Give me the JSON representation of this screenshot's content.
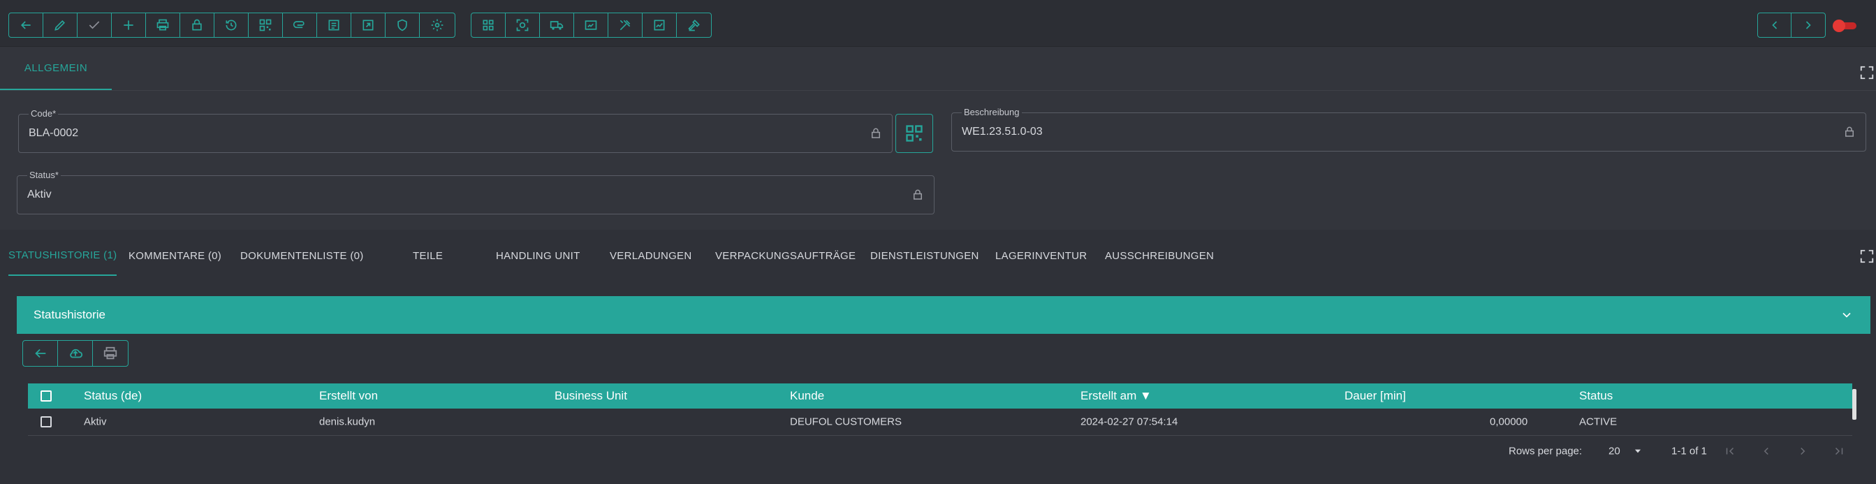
{
  "toolbar": {
    "group1_icons": [
      "back-arrow-icon",
      "pencil-icon",
      "check-icon",
      "plus-icon",
      "printer-icon",
      "lock-icon",
      "history-icon",
      "qr-code-icon",
      "paperclip-icon",
      "notes-icon",
      "export-icon",
      "shield-icon",
      "gear-icon"
    ],
    "group2_icons": [
      "grid-icon",
      "scan-target-icon",
      "truck-icon",
      "barcode-scan-icon",
      "tools-icon",
      "chart-doc-icon",
      "hammer-icon"
    ],
    "nav_icons": [
      "chevron-left-icon",
      "chevron-right-icon"
    ]
  },
  "general": {
    "tab_label": "ALLGEMEIN",
    "code": {
      "label": "Code*",
      "value": "BLA-0002"
    },
    "beschreibung": {
      "label": "Beschreibung",
      "value": "WE1.23.51.0-03"
    },
    "status": {
      "label": "Status*",
      "value": "Aktiv"
    }
  },
  "subtabs": [
    "STATUSHISTORIE (1)",
    "KOMMENTARE (0)",
    "DOKUMENTENLISTE (0)",
    "TEILE",
    "HANDLING UNIT",
    "VERLADUNGEN",
    "VERPACKUNGSAUFTRÄGE",
    "DIENSTLEISTUNGEN",
    "LAGERINVENTUR",
    "AUSSCHREIBUNGEN"
  ],
  "panel": {
    "title": "Statushistorie"
  },
  "table": {
    "columns": [
      "Status (de)",
      "Erstellt von",
      "Business Unit",
      "Kunde",
      "Erstellt am ▼",
      "Dauer [min]",
      "Status"
    ],
    "rows": [
      [
        "Aktiv",
        "denis.kudyn",
        "",
        "DEUFOL CUSTOMERS",
        "2024-02-27 07:54:14",
        "0,00000",
        "ACTIVE"
      ]
    ]
  },
  "pagination": {
    "rows_per_page_label": "Rows per page:",
    "rows_per_page_value": "20",
    "range": "1-1 of 1"
  },
  "colors": {
    "accent": "#26a69a",
    "background": "#2f3138",
    "toggle": "#e53935"
  }
}
